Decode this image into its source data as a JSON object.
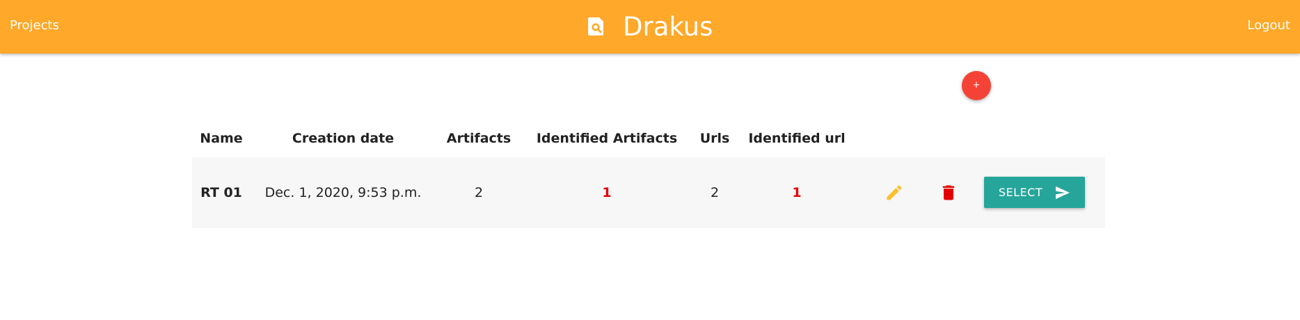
{
  "navbar": {
    "left_link": "Projects",
    "brand": "Drakus",
    "brand_icon": "document-search-icon",
    "right_link": "Logout",
    "color": "#ffa829"
  },
  "add_button": {
    "label": "+",
    "color": "#f44336"
  },
  "table": {
    "headers": {
      "name": "Name",
      "creation_date": "Creation date",
      "artifacts": "Artifacts",
      "identified_artifacts": "Identified Artifacts",
      "urls": "Urls",
      "identified_url": "Identified url"
    },
    "rows": [
      {
        "name": "RT 01",
        "creation_date": "Dec. 1, 2020, 9:53 p.m.",
        "artifacts": "2",
        "identified_artifacts": "1",
        "urls": "2",
        "identified_url": "1",
        "edit_icon": "pencil-icon",
        "delete_icon": "trash-icon",
        "select_label": "SELECT",
        "select_icon": "send-icon"
      }
    ]
  },
  "colors": {
    "identified_value": "#e30000",
    "edit_icon": "#fbc02d",
    "delete_icon": "#e30000",
    "select_button": "#26a69a",
    "row_background": "#f7f7f7"
  }
}
